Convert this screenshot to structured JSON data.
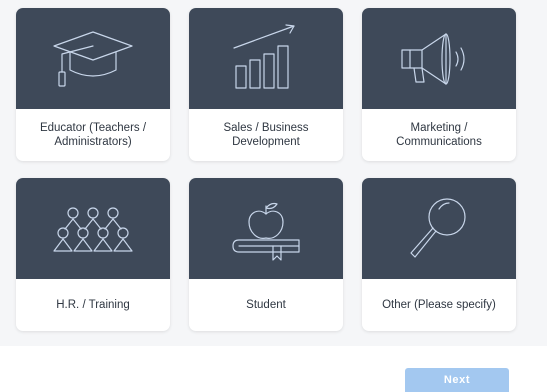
{
  "cards": [
    {
      "label": "Educator (Teachers /\nAdministrators)",
      "icon": "graduation-cap-icon"
    },
    {
      "label": "Sales / Business\nDevelopment",
      "icon": "growth-chart-icon"
    },
    {
      "label": "Marketing /\nCommunications",
      "icon": "megaphone-icon"
    },
    {
      "label": "H.R. / Training",
      "icon": "people-group-icon"
    },
    {
      "label": "Student",
      "icon": "apple-books-icon"
    },
    {
      "label": "Other (Please specify)",
      "icon": "magnifying-glass-icon"
    }
  ],
  "next_label": "Next",
  "colors": {
    "card_art": "#3e4959",
    "icon_stroke": "#c8d6ea",
    "next_button": "#a3c8f0",
    "panel": "#f5f6f8"
  }
}
